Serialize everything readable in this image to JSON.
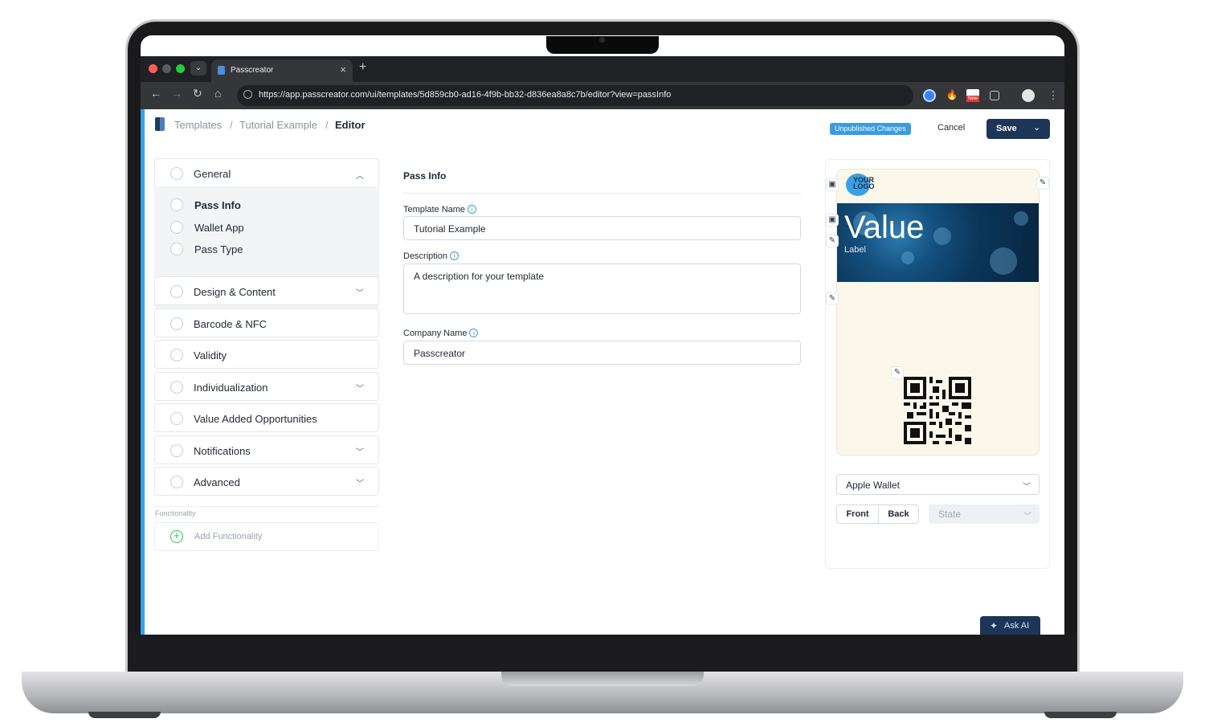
{
  "browser": {
    "tab_title": "Passcreator",
    "tab_close": "×",
    "new_tab": "+",
    "url": "https://app.passcreator.com/ui/templates/5d859cb0-ad16-4f9b-bb32-d836ea8a8c7b/editor?view=passInfo",
    "back": "←",
    "forward": "→",
    "reload": "↻",
    "home": "⌂",
    "tab_dropdown": "⌄",
    "extension_badge": "New"
  },
  "header": {
    "breadcrumb": [
      "Templates",
      "Tutorial Example",
      "Editor"
    ],
    "separator": "/",
    "badge": "Unpublished Changes",
    "cancel": "Cancel",
    "save": "Save",
    "save_chevron": "⌄"
  },
  "sidebar": {
    "general": {
      "label": "General",
      "expanded": true,
      "children": [
        "Pass Info",
        "Wallet App",
        "Pass Type"
      ],
      "active_child": "Pass Info"
    },
    "items": [
      {
        "label": "Design & Content",
        "has_chevron": true
      },
      {
        "label": "Barcode & NFC",
        "has_chevron": false
      },
      {
        "label": "Validity",
        "has_chevron": false
      },
      {
        "label": "Individualization",
        "has_chevron": true
      },
      {
        "label": "Value Added Opportunities",
        "has_chevron": false
      },
      {
        "label": "Notifications",
        "has_chevron": true
      },
      {
        "label": "Advanced",
        "has_chevron": true
      }
    ],
    "functionality_heading": "Functionality",
    "add_functionality": "Add Functionality",
    "add_symbol": "+"
  },
  "form": {
    "title": "Pass Info",
    "template_name_label": "Template Name",
    "template_name_value": "Tutorial Example",
    "description_label": "Description",
    "description_value": "A description for your template",
    "company_name_label": "Company Name",
    "company_name_value": "Passcreator",
    "info_symbol": "i"
  },
  "preview": {
    "logo_text_line1": "YOUR",
    "logo_text_line2": "LOGO",
    "value": "Value",
    "label": "Label",
    "wallet_select": "Apple Wallet",
    "front": "Front",
    "back": "Back",
    "state_placeholder": "State",
    "ask_ai": "Ask AI",
    "ask_ai_icon": "✦",
    "accent_color": "#1d3557",
    "badge_color": "#3b9be0"
  }
}
